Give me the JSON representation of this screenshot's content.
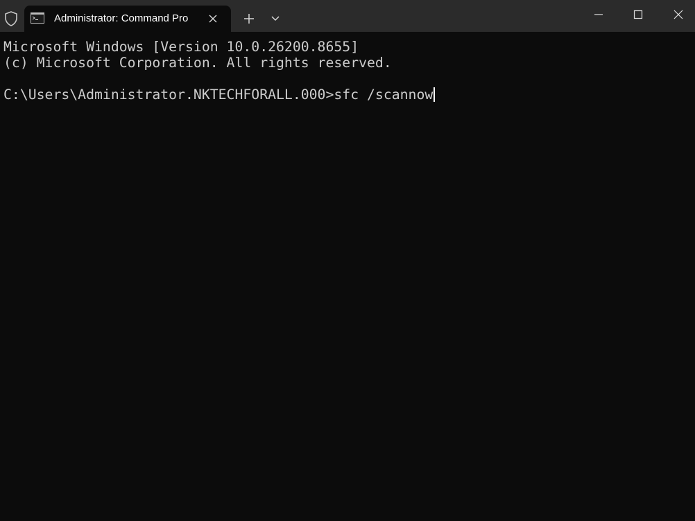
{
  "window": {
    "tab_title": "Administrator: Command Pro",
    "icons": {
      "shield": "shield-icon",
      "tab": "command-prompt-icon",
      "tab_close": "close-icon",
      "new_tab": "plus-icon",
      "dropdown": "chevron-down-icon",
      "minimize": "minimize-icon",
      "maximize": "maximize-icon",
      "close": "close-icon"
    }
  },
  "console": {
    "lines": [
      "Microsoft Windows [Version 10.0.26200.8655]",
      "(c) Microsoft Corporation. All rights reserved.",
      "",
      "C:\\Users\\Administrator.NKTECHFORALL.000>sfc /scannow"
    ]
  },
  "colors": {
    "background": "#0c0c0c",
    "titlebar": "#2b2b2b",
    "text": "#cccccc"
  }
}
